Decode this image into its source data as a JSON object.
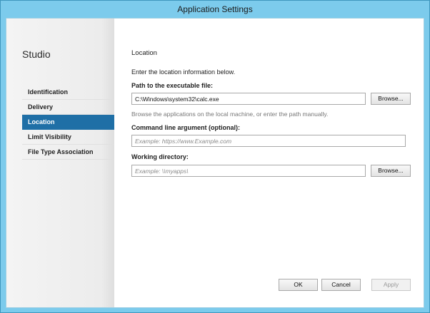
{
  "window": {
    "title": "Application Settings"
  },
  "sidebar": {
    "title": "Studio",
    "items": [
      {
        "label": "Identification"
      },
      {
        "label": "Delivery"
      },
      {
        "label": "Location",
        "active": true
      },
      {
        "label": "Limit Visibility"
      },
      {
        "label": "File Type Association"
      }
    ]
  },
  "main": {
    "section_title": "Location",
    "intro": "Enter the location information below.",
    "exe_label": "Path to the executable file:",
    "exe_value": "C:\\Windows\\system32\\calc.exe",
    "browse_label": "Browse...",
    "exe_hint": "Browse the applications on the local machine, or enter the path manually.",
    "cmd_label": "Command line argument (optional):",
    "cmd_placeholder": "Example: https://www.Example.com",
    "workdir_label": "Working directory:",
    "workdir_placeholder": "Example: \\\\myapps\\",
    "browse2_label": "Browse..."
  },
  "footer": {
    "ok": "OK",
    "cancel": "Cancel",
    "apply": "Apply"
  },
  "colors": {
    "title_bar": "#7ccbec",
    "active_nav": "#1f6fa6"
  }
}
